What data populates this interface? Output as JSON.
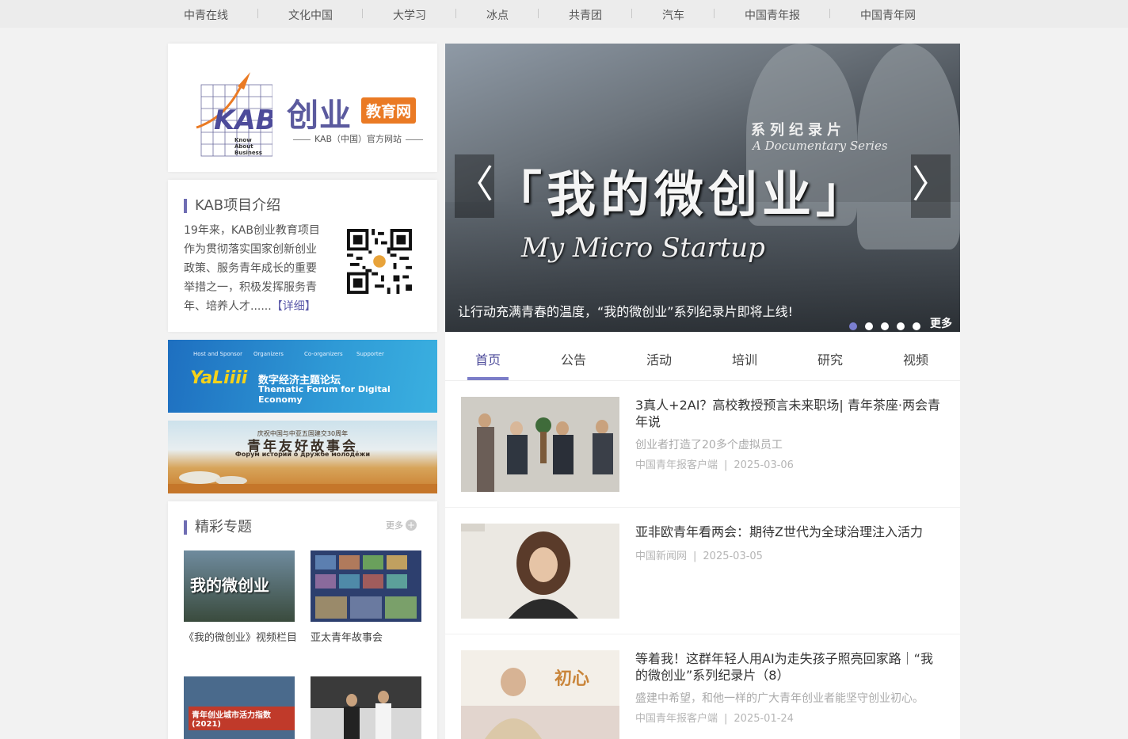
{
  "topnav": [
    "中青在线",
    "文化中国",
    "大学习",
    "冰点",
    "共青团",
    "汽车",
    "中国青年报",
    "中国青年网"
  ],
  "logo": {
    "kab_letters": "KAB",
    "kab_words": [
      "Know",
      "About",
      "Business"
    ],
    "title": "创业",
    "badge": "教育网",
    "subtitle": "KAB（中国）官方网站"
  },
  "intro": {
    "heading": "KAB项目介绍",
    "text": "19年来，KAB创业教育项目作为贯彻落实国家创新创业政策、服务青年成长的重要举措之一，积极发挥服务青年、培养人才......",
    "more": "【详细】"
  },
  "banner1": {
    "logo": "YaLiiii",
    "title": "数字经济主题论坛",
    "subtitle": "Thematic Forum for Digital Economy",
    "meta": [
      "Host and Sponsor",
      "Organizers",
      "Co-organizers",
      "Supporter"
    ]
  },
  "banner2": {
    "small": "庆祝中国与中亚五国建交30周年",
    "title": "青年友好故事会",
    "ru": "Форум историй о дружбе молодёжи"
  },
  "topics": {
    "heading": "精彩专题",
    "more": "更多",
    "items": [
      {
        "caption": "《我的微创业》视频栏目",
        "thumb_text": "我的微创业"
      },
      {
        "caption": "亚太青年故事会",
        "thumb_text": ""
      },
      {
        "caption": "",
        "thumb_text": "青年创业城市活力指数(2021)"
      },
      {
        "caption": "",
        "thumb_text": ""
      }
    ]
  },
  "slider": {
    "series_cn": "系列纪录片",
    "series_en": "A Documentary Series",
    "main_cn": "「我的微创业」",
    "main_en": "My Micro Startup",
    "caption": "让行动充满青春的温度，“我的微创业”系列纪录片即将上线!",
    "more": "更多",
    "prev": "〈",
    "next": "〉",
    "dot_count": 5,
    "active_dot": 1
  },
  "tabs": [
    "首页",
    "公告",
    "活动",
    "培训",
    "研究",
    "视频"
  ],
  "active_tab": "首页",
  "news": [
    {
      "title": "3真人+2AI？高校教授预言未来职场| 青年茶座·两会青年说",
      "sub": "创业者打造了20多个虚拟员工",
      "source": "中国青年报客户端",
      "date": "2025-03-06"
    },
    {
      "title": "亚非欧青年看两会：期待Z世代为全球治理注入活力",
      "sub": "",
      "source": "中国新闻网",
      "date": "2025-03-05"
    },
    {
      "title": "等着我！这群年轻人用AI为走失孩子照亮回家路｜“我的微创业”系列纪录片（8）",
      "sub": "盛建中希望，和他一样的广大青年创业者能坚守创业初心。",
      "source": "中国青年报客户端",
      "date": "2025-01-24",
      "thumb_text": "初心"
    }
  ],
  "colors": {
    "accent": "#6f6db3",
    "orange": "#ea7a24",
    "bg": "#f2f2f2"
  }
}
